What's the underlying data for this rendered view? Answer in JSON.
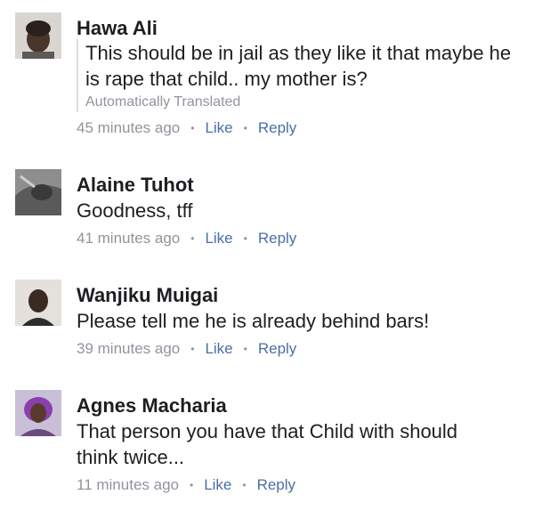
{
  "comments": [
    {
      "author": "Hawa Ali",
      "text": "This should be in jail as they like it that maybe he is rape that child.. my mother is?",
      "translation_note": "Automatically Translated",
      "time": "45 minutes ago",
      "like": "Like",
      "reply": "Reply"
    },
    {
      "author": "Alaine Tuhot",
      "text": "Goodness, tff",
      "time": "41 minutes ago",
      "like": "Like",
      "reply": "Reply"
    },
    {
      "author": "Wanjiku Muigai",
      "text": "Please tell me he is already behind bars!",
      "time": "39 minutes ago",
      "like": "Like",
      "reply": "Reply"
    },
    {
      "author": "Agnes Macharia",
      "text": "That person you have that Child with should think twice...",
      "time": "11 minutes ago",
      "like": "Like",
      "reply": "Reply"
    }
  ],
  "separator": "•",
  "colors": {
    "action_link": "#4b6ea8",
    "meta_gray": "#90949c",
    "text": "#1c1e21"
  }
}
